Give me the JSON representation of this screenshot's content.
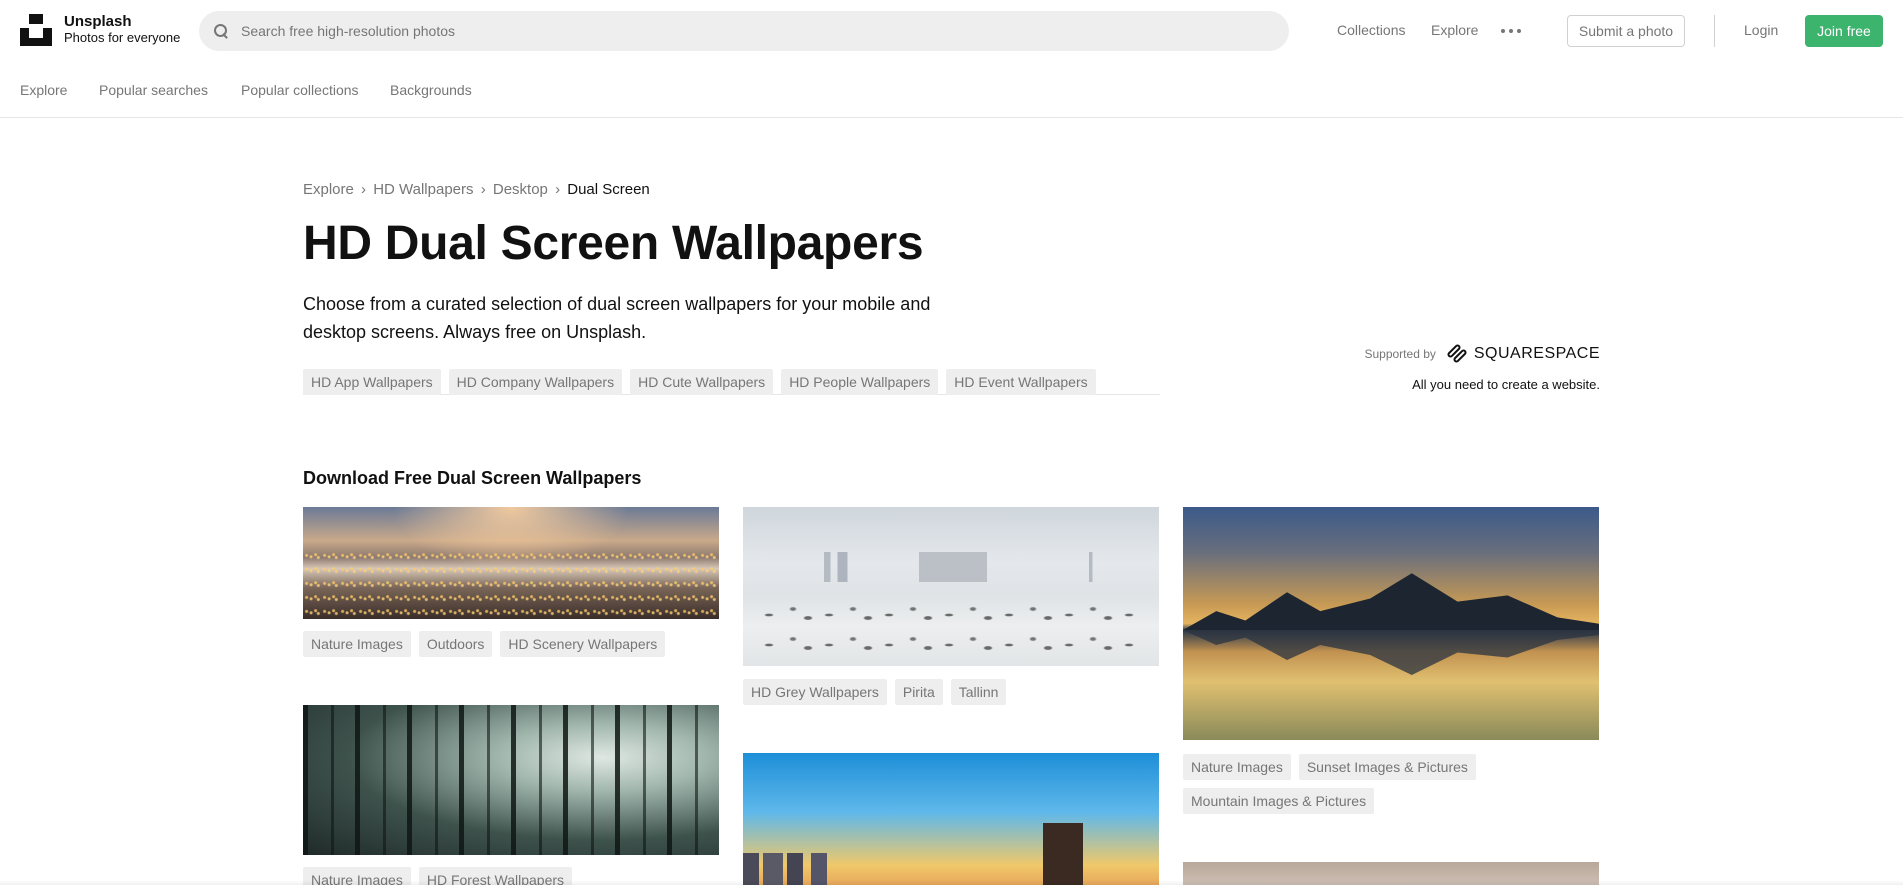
{
  "brand": {
    "name": "Unsplash",
    "tagline": "Photos for everyone"
  },
  "search": {
    "placeholder": "Search free high-resolution photos",
    "value": ""
  },
  "topnav": {
    "collections": "Collections",
    "explore": "Explore",
    "submit": "Submit a photo",
    "login": "Login",
    "join": "Join free"
  },
  "subnav": [
    "Explore",
    "Popular searches",
    "Popular collections",
    "Backgrounds"
  ],
  "breadcrumb": [
    "Explore",
    "HD Wallpapers",
    "Desktop",
    "Dual Screen"
  ],
  "breadcrumb_sep": "›",
  "title": "HD Dual Screen Wallpapers",
  "description": "Choose from a curated selection of dual screen wallpapers for your mobile and desktop screens. Always free on Unsplash.",
  "related_tags": [
    "HD App Wallpapers",
    "HD Company Wallpapers",
    "HD Cute Wallpapers",
    "HD People Wallpapers",
    "HD Event Wallpapers"
  ],
  "sponsor": {
    "label": "Supported by",
    "brand": "SQUARESPACE",
    "sub": "All you need to create a website."
  },
  "section_title": "Download Free Dual Screen Wallpapers",
  "photos": [
    {
      "tags": [
        "Nature Images",
        "Outdoors",
        "HD Scenery Wallpapers"
      ]
    },
    {
      "tags": [
        "HD Grey Wallpapers",
        "Pirita",
        "Tallinn"
      ]
    },
    {
      "tags": [
        "Nature Images",
        "Sunset Images & Pictures",
        "Mountain Images & Pictures"
      ]
    },
    {
      "tags": [
        "Nature Images",
        "HD Forest Wallpapers"
      ]
    }
  ],
  "colors": {
    "accent_green": "#3cb46e",
    "muted_text": "#767676",
    "tag_bg": "#eeeeee"
  },
  "icons": [
    "unsplash-logo",
    "search-icon",
    "more-icon",
    "squarespace-logo"
  ]
}
